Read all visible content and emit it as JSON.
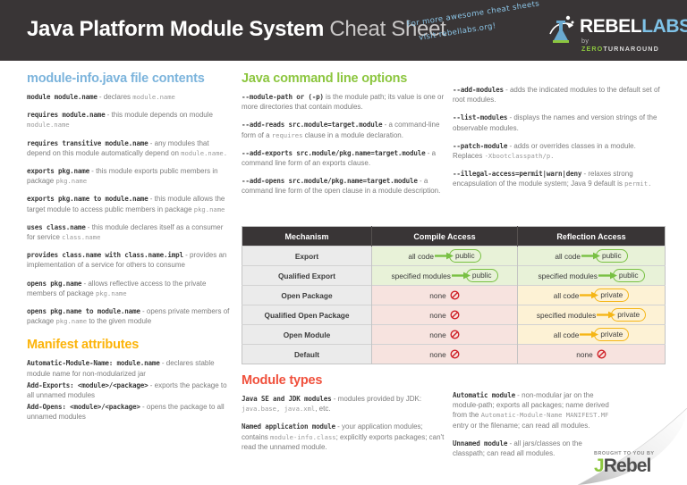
{
  "header": {
    "title_main": "Java Platform Module System",
    "title_sub": "Cheat Sheet",
    "promo_line1": "For more awesome cheat sheets",
    "promo_line2": "visit rebellabs.org!",
    "logo_word1": "REBEL",
    "logo_word2": "LABS",
    "logo_by": "by ",
    "logo_zero": "ZERO",
    "logo_turnaround": "TURNAROUND",
    "bg_color": "#393536"
  },
  "sections": {
    "module_info": {
      "title": "module-info.java file contents",
      "color": "#7cb4dc",
      "entries": [
        {
          "code": "module module.name",
          "text": " - declares ",
          "code2": "module.name"
        },
        {
          "code": "requires module.name",
          "text": " - this module depends on module ",
          "code2": "module.name"
        },
        {
          "code": "requires transitive module.name",
          "text": " - any modules that depend on this module automatically depend on ",
          "code2": "module.name."
        },
        {
          "code": "exports pkg.name",
          "text": " - this module exports public members in package ",
          "code2": "pkg.name"
        },
        {
          "code": "exports pkg.name to module.name",
          "text": " - this module allows the target module to access public members in package ",
          "code2": "pkg.name"
        },
        {
          "code": "uses class.name",
          "text": " - this module declares itself as a consumer for service ",
          "code2": "class.name"
        },
        {
          "code": "provides class.name with class.name.impl",
          "text": " - provides an implementation of a service for others to consume",
          "code2": ""
        },
        {
          "code": "opens pkg.name",
          "text": " - allows reflective access to the private members of package ",
          "code2": "pkg.name"
        },
        {
          "code": "opens pkg.name to module.name",
          "text": " - opens private members of package ",
          "code2": "pkg.name",
          "text2": " to the given module"
        }
      ]
    },
    "manifest": {
      "title": "Manifest attributes",
      "color": "#fcb40a",
      "entries": [
        {
          "code": "Automatic-Module-Name: module.name",
          "text": " - declares stable module name for non-modularized jar"
        },
        {
          "code": "Add-Exports: <module>/<package>",
          "text": " - exports the package to all unnamed modules"
        },
        {
          "code": "Add-Opens: <module>/<package>",
          "text": " - opens the package to all unnamed modules"
        }
      ]
    },
    "cmdline": {
      "title": "Java command line options",
      "color": "#8cc63f",
      "entries_left": [
        {
          "code": "--module-path or (-p)",
          "text": " is the module path; its value is one or more directories that contain modules."
        },
        {
          "code": "--add-reads src.module=target.module",
          "text": " - a command-line form of a ",
          "code2": "requires",
          "text2": " clause in a module declaration."
        },
        {
          "code": "--add-exports src.module/pkg.name=target.module",
          "text": " - a command line form of an exports clause."
        },
        {
          "code": "--add-opens src.module/pkg.name=target.module",
          "text": " - a command line form of the open clause in a module description."
        }
      ],
      "entries_right": [
        {
          "code": "--add-modules",
          "text": " - adds the indicated modules to the default set of root modules."
        },
        {
          "code": "--list-modules",
          "text": " - displays the names and version strings of the observable modules."
        },
        {
          "code": "--patch-module",
          "text": " - adds or overrides classes in a module. Replaces ",
          "code2": "-Xbootclasspath/p."
        },
        {
          "code": "--illegal-access=permit|warn|deny",
          "text": " - relaxes strong encapsulation of the module system; Java 9 default is ",
          "code2": "permit."
        }
      ]
    },
    "module_types": {
      "title": "Module types",
      "color": "#f0503c",
      "entries_left": [
        {
          "code": "Java SE and JDK modules",
          "text": " - modules provided by JDK: ",
          "code2": "java.base, java.xml",
          "text2": ", etc."
        },
        {
          "code": "Named application module",
          "text": " - your application modules; contains ",
          "code2": "module-info.class",
          "text2": "; explicitly exports packages; can't read the unnamed module."
        }
      ],
      "entries_right": [
        {
          "code": "Automatic module",
          "text": " - non-modular jar on the module-path; exports all packages; name derived from the ",
          "code2": "Automatic-Module-Name MANIFEST.MF",
          "text2": " entry or the filename; can read all modules."
        },
        {
          "code": "Unnamed module",
          "text": " - all jars/classes on the classpath; can read all modules."
        }
      ]
    }
  },
  "table": {
    "headers": [
      "Mechanism",
      "Compile Access",
      "Reflection Access"
    ],
    "rows": [
      {
        "mechanism": "Export",
        "compile": {
          "kind": "flow",
          "from": "all code",
          "to": "public",
          "tone": "green"
        },
        "reflection": {
          "kind": "flow",
          "from": "all code",
          "to": "public",
          "tone": "green"
        }
      },
      {
        "mechanism": "Qualified Export",
        "compile": {
          "kind": "flow",
          "from": "specified modules",
          "to": "public",
          "tone": "green"
        },
        "reflection": {
          "kind": "flow",
          "from": "specified modules",
          "to": "public",
          "tone": "green"
        }
      },
      {
        "mechanism": "Open Package",
        "compile": {
          "kind": "none",
          "label": "none",
          "tone": "red"
        },
        "reflection": {
          "kind": "flow",
          "from": "all code",
          "to": "private",
          "tone": "amber"
        }
      },
      {
        "mechanism": "Qualified Open Package",
        "compile": {
          "kind": "none",
          "label": "none",
          "tone": "red"
        },
        "reflection": {
          "kind": "flow",
          "from": "specified modules",
          "to": "private",
          "tone": "amber"
        }
      },
      {
        "mechanism": "Open Module",
        "compile": {
          "kind": "none",
          "label": "none",
          "tone": "red"
        },
        "reflection": {
          "kind": "flow",
          "from": "all code",
          "to": "private",
          "tone": "amber"
        }
      },
      {
        "mechanism": "Default",
        "compile": {
          "kind": "none",
          "label": "none",
          "tone": "red"
        },
        "reflection": {
          "kind": "none",
          "label": "none",
          "tone": "red"
        }
      }
    ],
    "colors": {
      "green": "#78c043",
      "amber": "#f5b617",
      "red": "#cf2027"
    }
  },
  "footer": {
    "brought_by": "BROUGHT TO YOU BY",
    "logo_j": "J",
    "logo_rest": "Rebel"
  }
}
